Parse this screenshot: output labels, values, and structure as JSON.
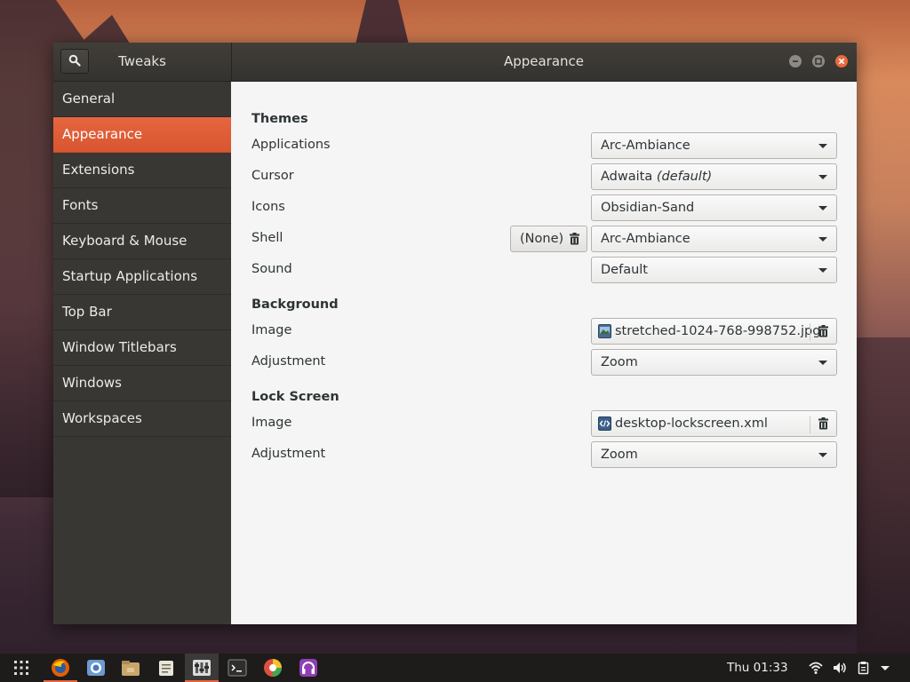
{
  "window": {
    "app_title": "Tweaks",
    "page_title": "Appearance"
  },
  "sidebar": {
    "items": [
      {
        "label": "General"
      },
      {
        "label": "Appearance",
        "active": true
      },
      {
        "label": "Extensions"
      },
      {
        "label": "Fonts"
      },
      {
        "label": "Keyboard & Mouse"
      },
      {
        "label": "Startup Applications"
      },
      {
        "label": "Top Bar"
      },
      {
        "label": "Window Titlebars"
      },
      {
        "label": "Windows"
      },
      {
        "label": "Workspaces"
      }
    ]
  },
  "themes": {
    "heading": "Themes",
    "applications": {
      "label": "Applications",
      "value": "Arc-Ambiance"
    },
    "cursor": {
      "label": "Cursor",
      "value": "Adwaita",
      "suffix": "(default)"
    },
    "icons": {
      "label": "Icons",
      "value": "Obsidian-Sand"
    },
    "shell": {
      "label": "Shell",
      "value": "Arc-Ambiance",
      "extra_button": "(None)"
    },
    "sound": {
      "label": "Sound",
      "value": "Default"
    }
  },
  "background": {
    "heading": "Background",
    "image": {
      "label": "Image",
      "value": "stretched-1024-768-998752.jpg"
    },
    "adjustment": {
      "label": "Adjustment",
      "value": "Zoom"
    }
  },
  "lock_screen": {
    "heading": "Lock Screen",
    "image": {
      "label": "Image",
      "value": "desktop-lockscreen.xml"
    },
    "adjustment": {
      "label": "Adjustment",
      "value": "Zoom"
    }
  },
  "taskbar": {
    "clock": "Thu 01:33",
    "apps": [
      "firefox-icon",
      "chromium-icon",
      "files-icon",
      "gimp-icon",
      "tweaks-icon",
      "terminal-icon",
      "color-picker-icon",
      "headphones-icon"
    ]
  },
  "colors": {
    "accent": "#e5663f",
    "sidebar_bg": "#393734",
    "headerbar_bg": "#3b3935",
    "content_bg": "#f5f5f5"
  }
}
